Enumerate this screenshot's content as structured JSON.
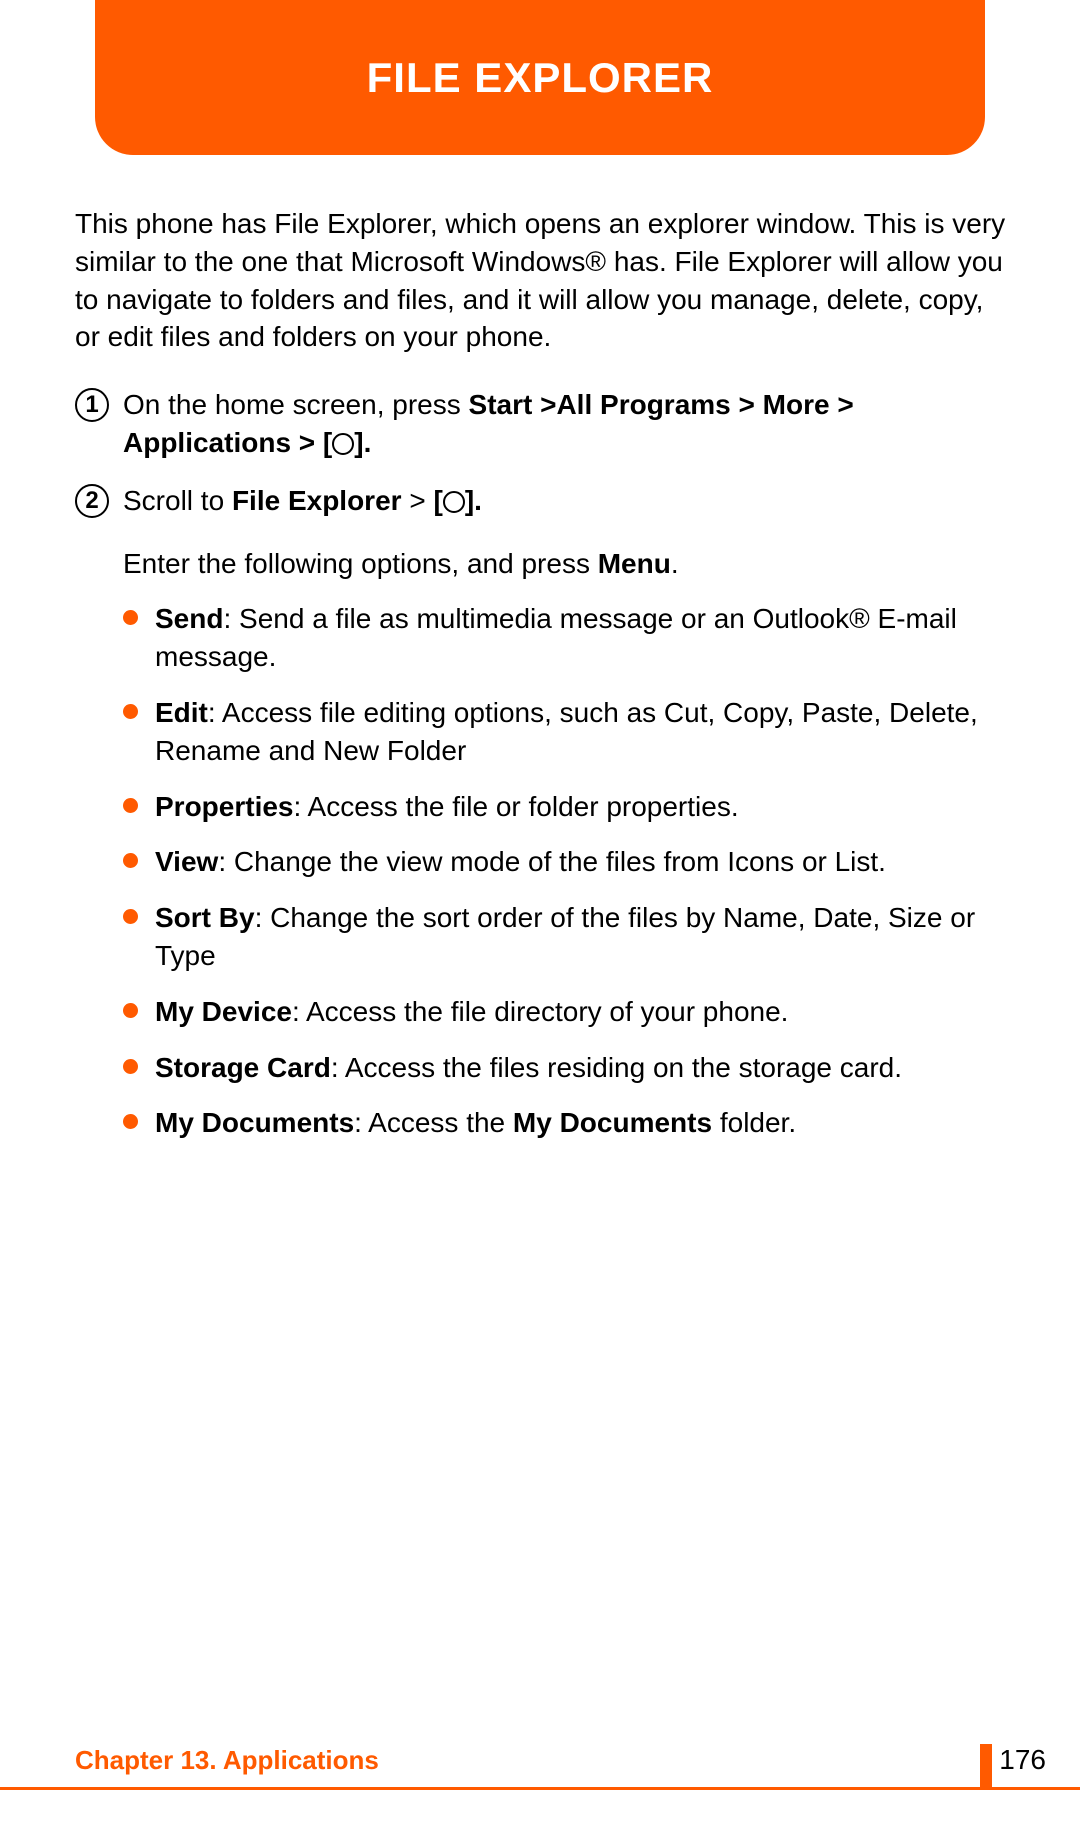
{
  "header": {
    "title": "FILE EXPLORER"
  },
  "intro": "This phone has File Explorer, which opens an explorer window. This is very similar to the one that Microsoft Windows® has. File Explorer will allow you to navigate to folders and files, and it will allow you manage, delete, copy, or edit files and folders on your phone.",
  "steps": {
    "s1_num": "1",
    "s1_a": "On the home screen, press ",
    "s1_b": "Start >",
    "s1_c": "All Programs > More > Applications > [",
    "s1_d": "].",
    "s2_num": "2",
    "s2_a": "Scroll to ",
    "s2_b": "File Explorer",
    "s2_c": " > ",
    "s2_d": "[",
    "s2_e": "].",
    "opts_intro_a": "Enter the following options, and press ",
    "opts_intro_b": "Menu",
    "opts_intro_c": "."
  },
  "options": {
    "o1_b": "Send",
    "o1_t": ": Send a file as multimedia message or an Outlook® E-mail message.",
    "o2_b": "Edit",
    "o2_t": ": Access file editing options, such as Cut, Copy, Paste, Delete, Rename and New Folder",
    "o3_b": "Properties",
    "o3_t": ": Access the file or folder properties.",
    "o4_b": "View",
    "o4_t": ": Change the view mode of the files from Icons or List.",
    "o5_b": "Sort By",
    "o5_t": ": Change the sort order of the files by Name, Date, Size or Type",
    "o6_b": "My Device",
    "o6_t": ": Access the file directory of your phone.",
    "o7_b": "Storage Card",
    "o7_t": ": Access the files residing on the storage card.",
    "o8_b": "My Documents",
    "o8_a": ": Access the ",
    "o8_c": "My Documents",
    "o8_d": " folder."
  },
  "footer": {
    "chapter": "Chapter 13. Applications",
    "page": "176"
  }
}
